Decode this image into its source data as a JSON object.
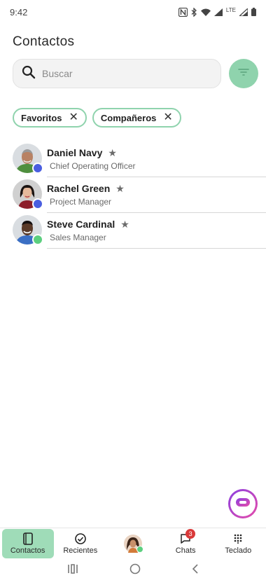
{
  "status_bar": {
    "time": "9:42",
    "network_label": "LTE"
  },
  "header": {
    "title": "Contactos"
  },
  "search": {
    "placeholder": "Buscar",
    "value": ""
  },
  "filter_chips": [
    {
      "label": "Favoritos"
    },
    {
      "label": "Compañeros"
    }
  ],
  "contacts": [
    {
      "name": "Daniel Navy",
      "role": "Chief Operating Officer",
      "favorite": true,
      "presence_color": "#4a5ee0"
    },
    {
      "name": "Rachel Green",
      "role": "Project Manager",
      "favorite": true,
      "presence_color": "#4a5ee0"
    },
    {
      "name": "Steve Cardinal",
      "role": "Sales Manager",
      "favorite": true,
      "presence_color": "#5ccf7f"
    }
  ],
  "bottom_nav": {
    "contacts_label": "Contactos",
    "recents_label": "Recientes",
    "chats_label": "Chats",
    "chats_badge": "3",
    "keypad_label": "Teclado"
  },
  "colors": {
    "accent": "#8fd3ad",
    "active_tab": "#9fdcb8",
    "badge": "#d93a3a"
  }
}
